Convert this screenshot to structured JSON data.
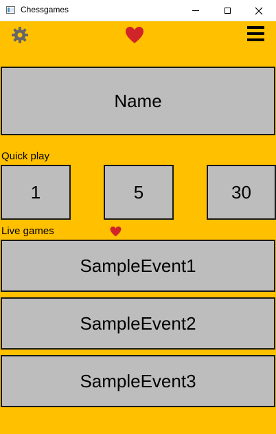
{
  "window": {
    "title": "Chessgames"
  },
  "colors": {
    "background": "#ffc000",
    "tile": "#bdbdbd",
    "heart": "#d0232a",
    "gear": "#666666"
  },
  "icons": {
    "settings": "gear-icon",
    "favorites": "heart-icon",
    "menu": "hamburger-menu-icon"
  },
  "main": {
    "name_button": "Name",
    "quick_play": {
      "label": "Quick play",
      "options": [
        "1",
        "5",
        "30"
      ]
    },
    "live_games": {
      "label": "Live games",
      "events": [
        "SampleEvent1",
        "SampleEvent2",
        "SampleEvent3"
      ]
    }
  }
}
